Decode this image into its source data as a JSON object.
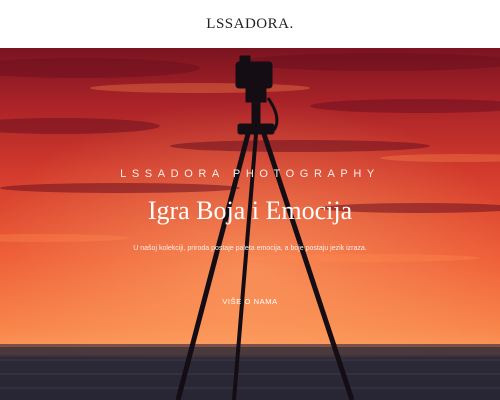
{
  "header": {
    "logo": "LSSADORA."
  },
  "hero": {
    "eyebrow": "LSSADORA PHOTOGRAPHY",
    "title": "Igra Boja i Emocija",
    "subtitle": "U našoj kolekciji, priroda postaje paleta emocija, a boje postaju jezik izraza.",
    "cta_label": "VIŠE O NAMA"
  }
}
